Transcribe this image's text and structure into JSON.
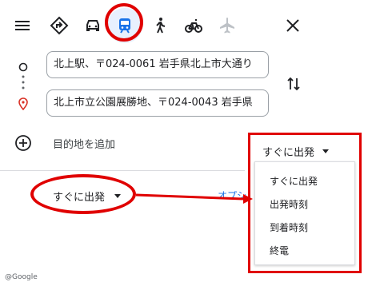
{
  "travel_modes": [
    {
      "name": "best",
      "icon": "diamond-directions-icon"
    },
    {
      "name": "driving",
      "icon": "car-icon"
    },
    {
      "name": "transit",
      "icon": "train-icon",
      "selected": true
    },
    {
      "name": "walking",
      "icon": "walk-icon"
    },
    {
      "name": "bicycling",
      "icon": "bike-icon"
    },
    {
      "name": "flights",
      "icon": "plane-icon",
      "disabled": true
    }
  ],
  "directions": {
    "origin": "北上駅、〒024-0061 岩手県北上市大通り",
    "destination": "北上市立公園展勝地、〒024-0043 岩手県",
    "add_destination": "目的地を追加"
  },
  "departure": {
    "main_label": "すぐに出発",
    "options_link": "オプシ",
    "dropdown_label": "すぐに出発",
    "options": [
      "すぐに出発",
      "出発時刻",
      "到着時刻",
      "終電"
    ]
  },
  "footer": {
    "copyright": "@Google"
  },
  "colors": {
    "accent": "#1a73e8",
    "annotation": "#e00000",
    "selected_bg": "#e8f0fe"
  }
}
